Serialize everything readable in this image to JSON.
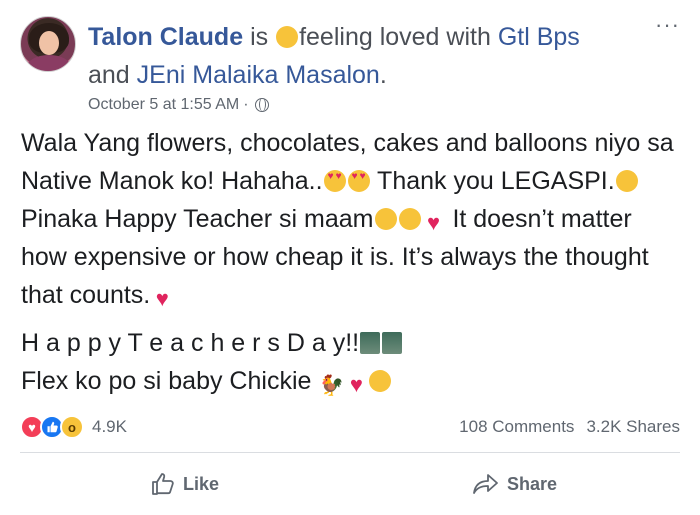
{
  "post": {
    "author": "Talon Claude",
    "verb": "is",
    "feeling_text": "feeling loved with",
    "tagged_1": "Gtl Bps",
    "connector": "and",
    "tagged_2": "JEni Malaika Masalon",
    "period": ".",
    "timestamp": "October 5 at 1:55 AM",
    "dot": "·",
    "more": "···",
    "body": {
      "line1_a": "Wala Yang flowers, chocolates, cakes and balloons niyo sa Native Manok ko! Hahaha..",
      "line1_b": " Thank you LEGASPI.",
      "line1_c": " Pinaka Happy Teacher si maam",
      "line1_d": " It doesn’t matter how expensive or how cheap it is. It’s always the thought that counts.",
      "line2_a": "H a p p y T e a c h e r s D a y!!",
      "line3_a": "Flex ko po si baby Chickie "
    }
  },
  "stats": {
    "reactions_count": "4.9K",
    "comments": "108 Comments",
    "shares": "3.2K Shares"
  },
  "actions": {
    "like": "Like",
    "share": "Share"
  },
  "colors": {
    "link": "#365899",
    "love": "#f33e58",
    "like": "#1877f2",
    "muted": "#606770"
  }
}
